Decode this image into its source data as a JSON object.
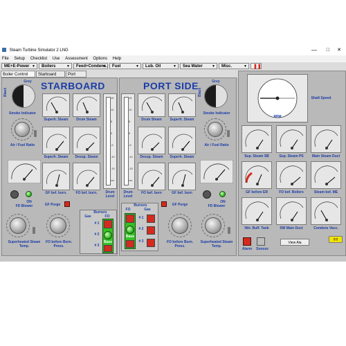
{
  "window": {
    "title": "Steam Turbine Simulator 2 LNG"
  },
  "menu": [
    "File",
    "Setup",
    "Checklist",
    "Use",
    "Assessment",
    "Options",
    "Help"
  ],
  "toolbar": [
    "ME+E-Power",
    "Boilers",
    "Feed+Condens.",
    "Fuel",
    "Lub. Oil",
    "Sea Water",
    "Misc."
  ],
  "tabs": [
    "Boiler Control Panel",
    "Starboard Boiler",
    "Port Boiler"
  ],
  "starboard": {
    "heading": "STARBOARD",
    "smoke_indicator": "Smoke Indicator",
    "smoke_top": "Grey",
    "smoke_left": "Black",
    "air_fuel_ratio": "Air / Fuel Ratio",
    "fd_blower": "FD Blower",
    "on": "ON",
    "superheated_steam_temp": "Superheated Steam Temp.",
    "fo_before_burn_press": "FO before Burn. Press.",
    "gf_purge": "GF Purge",
    "gauges": [
      "Superh. Steam",
      "Drum Steam",
      "Superh. Steam",
      "Desup. Steam",
      "GF bef. burn.",
      "FO bef. burn."
    ],
    "drum_level": "Drum Level",
    "burners": {
      "title": "Burners",
      "gas": "Gas",
      "fo": "FO",
      "base": "Base",
      "rows": [
        "# 1",
        "# 2",
        "# 3"
      ]
    }
  },
  "port": {
    "heading": "PORT SIDE",
    "smoke_indicator": "Smoke Indicator",
    "smoke_top": "Grey",
    "smoke_left": "Black",
    "air_fuel_ratio": "Air / Fuel Ratio",
    "fd_blower": "FD Blower",
    "on": "ON",
    "superheated_steam_temp": "Superheated Steam Temp.",
    "fo_before_burn_press": "FO before Burn. Press.",
    "gf_purge": "GF Purge",
    "gauges": [
      "Drum Steam",
      "Superh. Steam",
      "Desup. Steam",
      "Superh. Steam",
      "FO bef. burn",
      "GF bef. burn"
    ],
    "drum_level": "Drum Level",
    "burners": {
      "title": "Burners",
      "gas": "Gas",
      "fo": "FO",
      "base": "Base",
      "rows": [
        "# 1",
        "# 2",
        "# 3"
      ]
    }
  },
  "right_panel": {
    "shaft_speed": "Shaft Speed",
    "rpm": "RPM",
    "gauges": [
      "Sup. Steam SB",
      "Sup. Steam PS",
      "Main Steam Duct",
      "GF before ER",
      "FO bef. Boilers",
      "Steam bef. ME",
      "Nitr. Buff. Tank",
      "SW Main Duct",
      "Condens Vacc."
    ],
    "alarm": "Alarm",
    "snooze": "Snooze",
    "view_alarms": "View Ala",
    "yellow_button": "!!!!!"
  },
  "drum_scale": [
    "15",
    "10",
    "5",
    "0",
    "-5",
    "-10",
    "-15",
    "cm"
  ],
  "colors": {
    "heading": "#1a3ca8",
    "red": "#d52a1e",
    "green": "#35c124",
    "panel": "#b9b9b9"
  }
}
